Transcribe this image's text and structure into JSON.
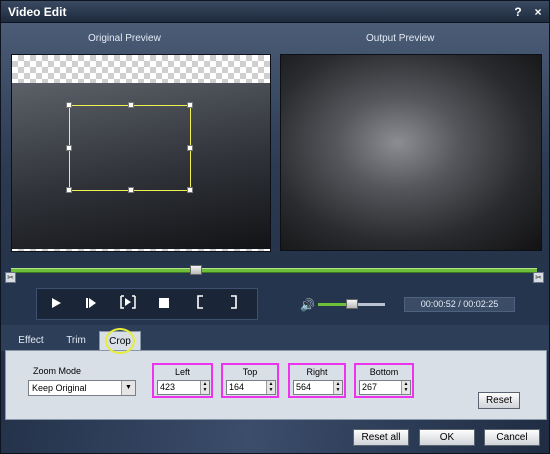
{
  "window": {
    "title": "Video Edit",
    "help_label": "?",
    "close_label": "×"
  },
  "preview": {
    "original_label": "Original Preview",
    "output_label": "Output Preview"
  },
  "playback": {
    "time_display": "00:00:52 / 00:02:25",
    "progress_fraction": 0.35,
    "volume_fraction": 0.45,
    "buttons": [
      {
        "name": "play",
        "icon": "play-icon"
      },
      {
        "name": "step-forward",
        "icon": "step-forward-icon"
      },
      {
        "name": "frame",
        "icon": "frame-step-icon"
      },
      {
        "name": "stop",
        "icon": "stop-icon"
      },
      {
        "name": "mark-in",
        "icon": "mark-in-icon"
      },
      {
        "name": "mark-out",
        "icon": "mark-out-icon"
      }
    ]
  },
  "tabs": [
    {
      "label": "Effect",
      "active": false
    },
    {
      "label": "Trim",
      "active": false
    },
    {
      "label": "Crop",
      "active": true
    }
  ],
  "crop": {
    "zoom_mode_label": "Zoom Mode",
    "zoom_mode_value": "Keep Original",
    "left_label": "Left",
    "left_value": "423",
    "top_label": "Top",
    "top_value": "164",
    "right_label": "Right",
    "right_value": "564",
    "bottom_label": "Bottom",
    "bottom_value": "267",
    "reset_label": "Reset"
  },
  "footer": {
    "reset_all_label": "Reset all",
    "ok_label": "OK",
    "cancel_label": "Cancel"
  },
  "colors": {
    "accent_green": "#6dbf3a",
    "highlight_magenta": "#ee33ee",
    "crop_box_yellow": "#f0f050"
  }
}
